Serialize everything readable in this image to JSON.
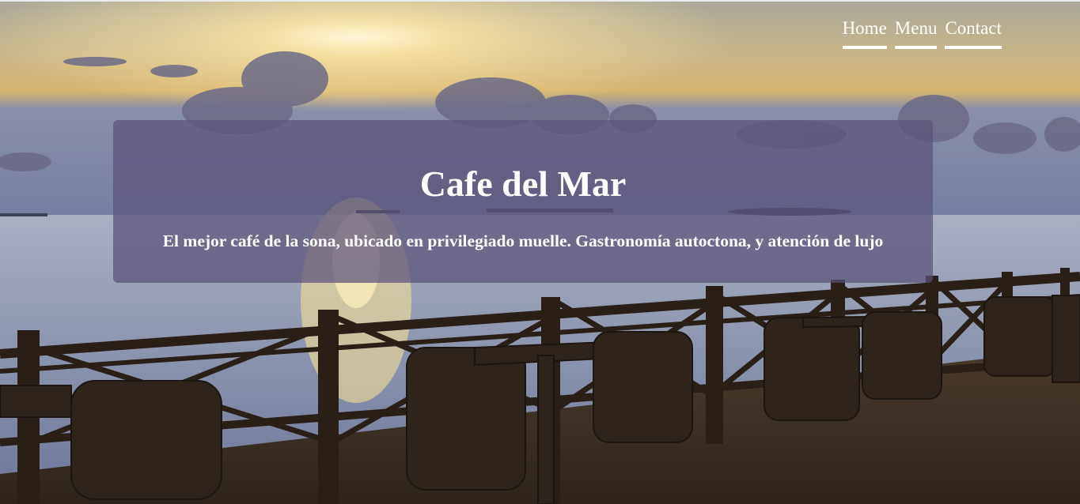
{
  "nav": {
    "items": [
      {
        "label": "Home"
      },
      {
        "label": "Menu"
      },
      {
        "label": "Contact"
      }
    ]
  },
  "hero": {
    "title": "Cafe del Mar",
    "subtitle": "El mejor café de la sona, ubicado en privilegiado muelle. Gastronomía autoctona, y atención de lujo"
  },
  "colors": {
    "banner_overlay": "#5a5278",
    "nav_text": "#ffffff",
    "sky_top": "#a9a7a0",
    "sun_glow": "#fff6cf",
    "deck": "#3a2d22"
  }
}
